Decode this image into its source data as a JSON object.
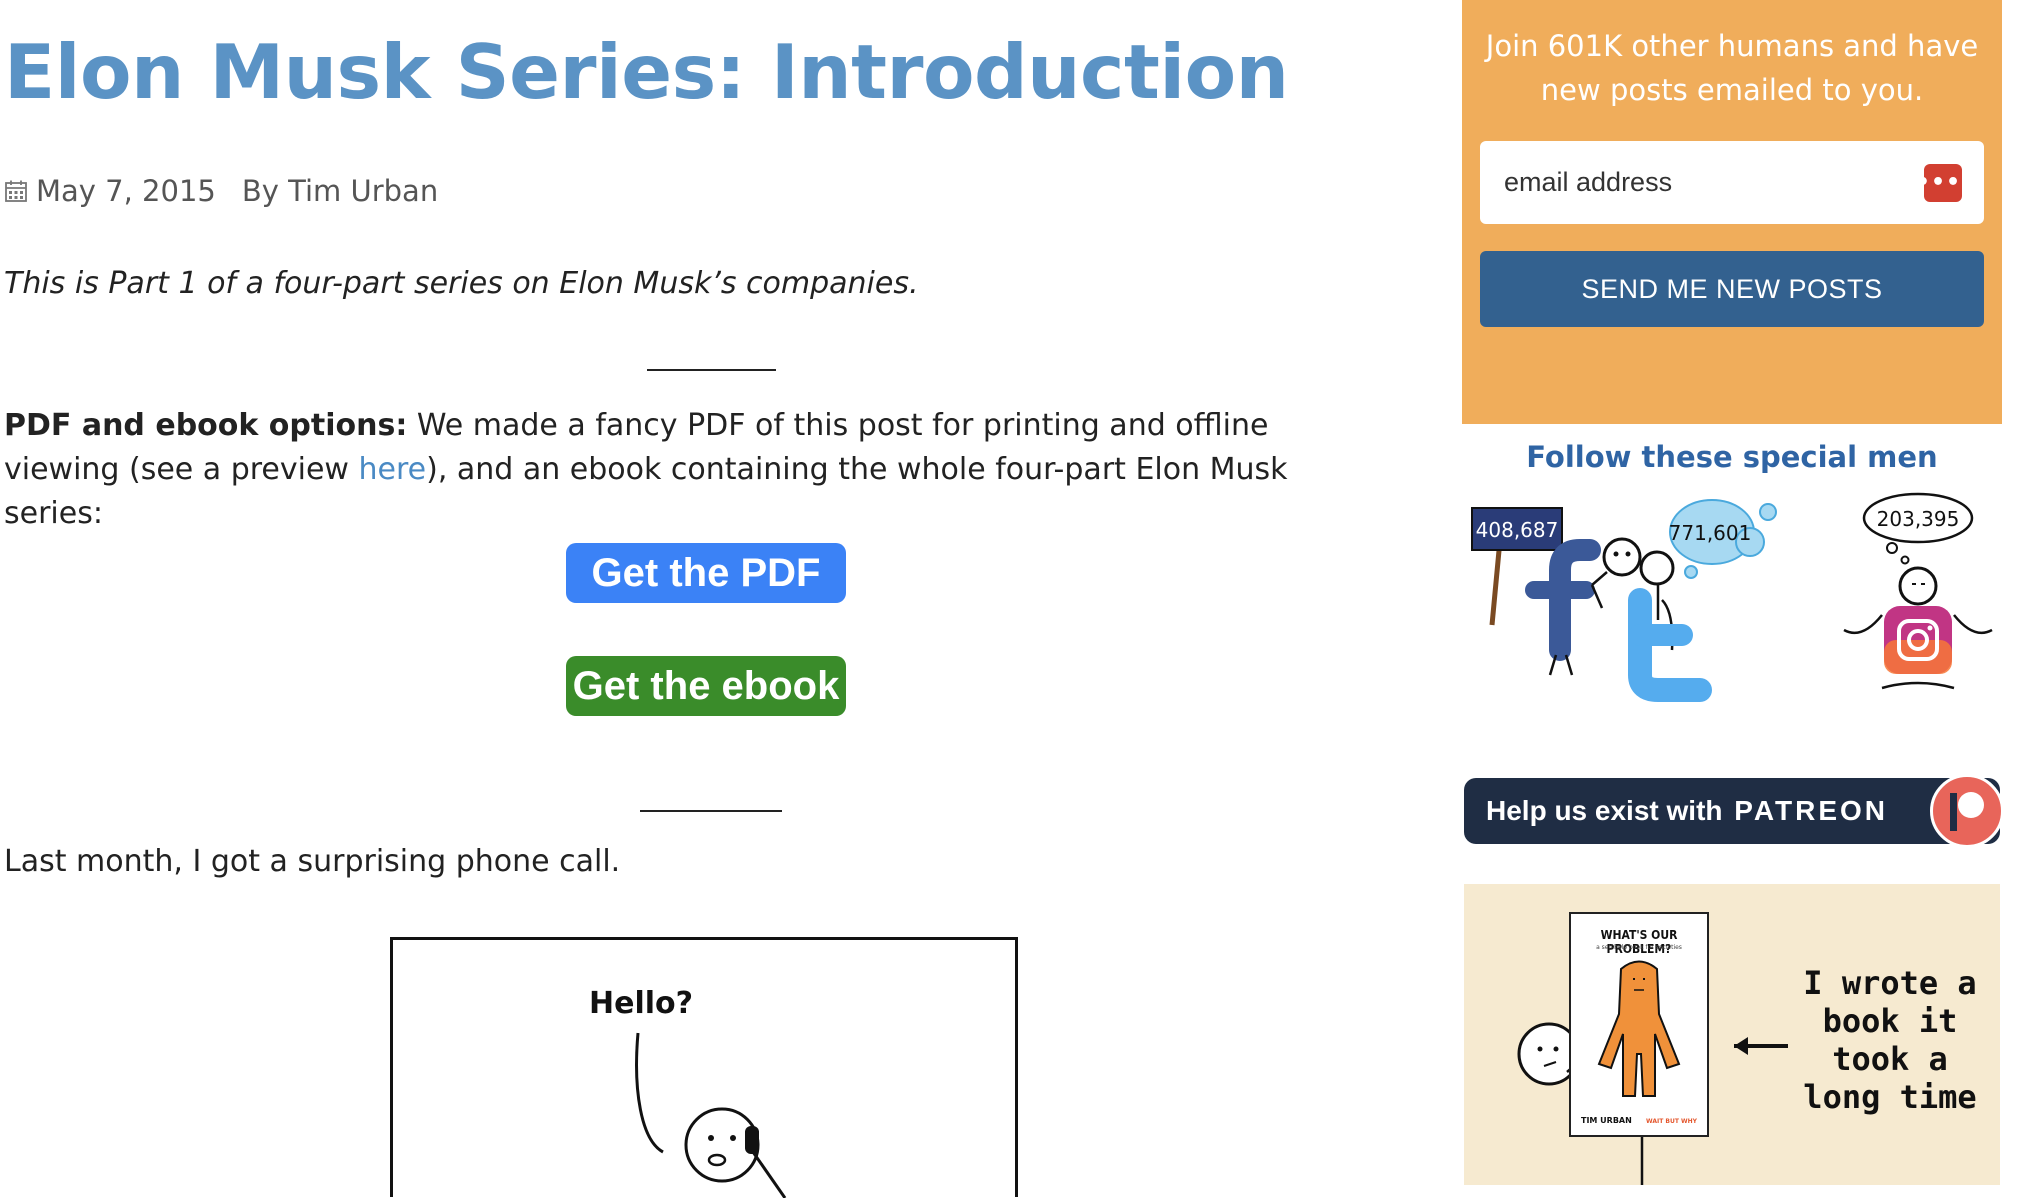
{
  "article": {
    "title": "Elon Musk Series: Introduction",
    "date": "May 7, 2015",
    "author": "By Tim Urban",
    "intro_italic": "This is Part 1 of a four-part series on Elon Musk’s companies.",
    "pdf_label": "PDF and ebook options:",
    "pdf_text_1": " We made a fancy PDF of this post for printing and offline viewing (see a preview ",
    "pdf_link": "here",
    "pdf_text_2": "), and an ebook containing the whole four-part Elon Musk series:",
    "btn_pdf": "Get the PDF",
    "btn_ebook": "Get the ebook",
    "last_month": "Last month, I got a surprising phone call.",
    "comic_text": "Hello?"
  },
  "sidebar": {
    "signup_text": "Join 601K other humans and have new posts emailed to you.",
    "email_placeholder": "email address",
    "pw_icon_text": "•••|",
    "send_button": "SEND ME NEW POSTS",
    "follow_title": "Follow these special men",
    "facebook_count": "408,687",
    "twitter_count": "771,601",
    "instagram_count": "203,395",
    "patreon_text": "Help us exist with",
    "patreon_brand": "PATREON",
    "book_cover_title": "WHAT'S OUR PROBLEM?",
    "book_cover_subtitle": "a self-help book for societies",
    "book_cover_author": "TIM URBAN",
    "book_cover_brand": "WAIT BUT WHY",
    "book_ad_text": "I wrote a book it took a long time"
  },
  "colors": {
    "title": "#5b93c5",
    "signup_bg": "#f0ad5b",
    "send_button": "#33618f",
    "pdf_button": "#3b82f6",
    "ebook_button": "#3a8c2a",
    "patreon_bg": "#1f2d44",
    "patreon_logo": "#e8655a"
  }
}
